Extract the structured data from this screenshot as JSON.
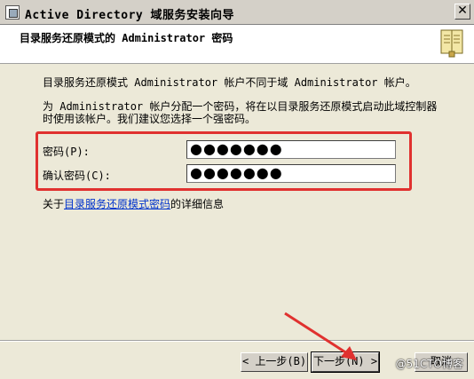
{
  "window": {
    "title": "Active Directory 域服务安装向导",
    "close_glyph": "✕"
  },
  "header": {
    "title": "目录服务还原模式的 Administrator 密码"
  },
  "body": {
    "paragraph1": "目录服务还原模式 Administrator 帐户不同于域 Administrator 帐户。",
    "paragraph2_line1": "为 Administrator 帐户分配一个密码，将在以目录服务还原模式启动此域控制器",
    "paragraph2_line2": "时使用该帐户。我们建议您选择一个强密码。"
  },
  "form": {
    "password_label": "密码(P):",
    "password_value": "●●●●●●●",
    "confirm_label": "确认密码(C):",
    "confirm_value": "●●●●●●●"
  },
  "info": {
    "prefix": "关于",
    "link": "目录服务还原模式密码",
    "suffix": "的详细信息"
  },
  "buttons": {
    "back": "< 上一步(B)",
    "next": "下一步(N) >",
    "cancel": "取消"
  },
  "watermark": "@51CTO博客",
  "colors": {
    "highlight_box": "#e0312f",
    "link": "#0033cc"
  }
}
